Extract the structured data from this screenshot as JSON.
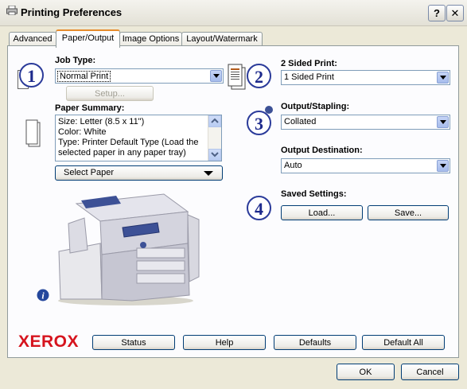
{
  "window": {
    "title": "Printing Preferences",
    "help_label": "?",
    "close_label": "✕"
  },
  "tabs": [
    {
      "label": "Advanced"
    },
    {
      "label": "Paper/Output"
    },
    {
      "label": "Image Options"
    },
    {
      "label": "Layout/Watermark"
    }
  ],
  "callouts": [
    "1",
    "2",
    "3",
    "4"
  ],
  "job_type": {
    "label": "Job Type:",
    "value": "Normal Print",
    "setup_label": "Setup..."
  },
  "paper_summary": {
    "label": "Paper Summary:",
    "lines": [
      "Size: Letter (8.5 x 11\")",
      "Color: White",
      "Type: Printer Default Type (Load the",
      "selected paper in any paper tray)"
    ],
    "select_label": "Select Paper"
  },
  "two_sided": {
    "label": "2 Sided Print:",
    "value": "1 Sided Print"
  },
  "output_stapling": {
    "label": "Output/Stapling:",
    "value": "Collated"
  },
  "output_destination": {
    "label": "Output Destination:",
    "value": "Auto"
  },
  "saved_settings": {
    "label": "Saved Settings:",
    "load_label": "Load...",
    "save_label": "Save..."
  },
  "brand": {
    "name": "XEROX",
    "color": "#d6141e"
  },
  "footer_buttons": {
    "status": "Status",
    "help": "Help",
    "defaults": "Defaults",
    "default_all": "Default All"
  },
  "dialog_buttons": {
    "ok": "OK",
    "cancel": "Cancel"
  },
  "icons": {
    "title": "printer-icon",
    "paper": "paper-stack-icon",
    "duplex": "document-pages-icon",
    "info": "info-icon",
    "printer_image": "xerox-printer-image"
  }
}
